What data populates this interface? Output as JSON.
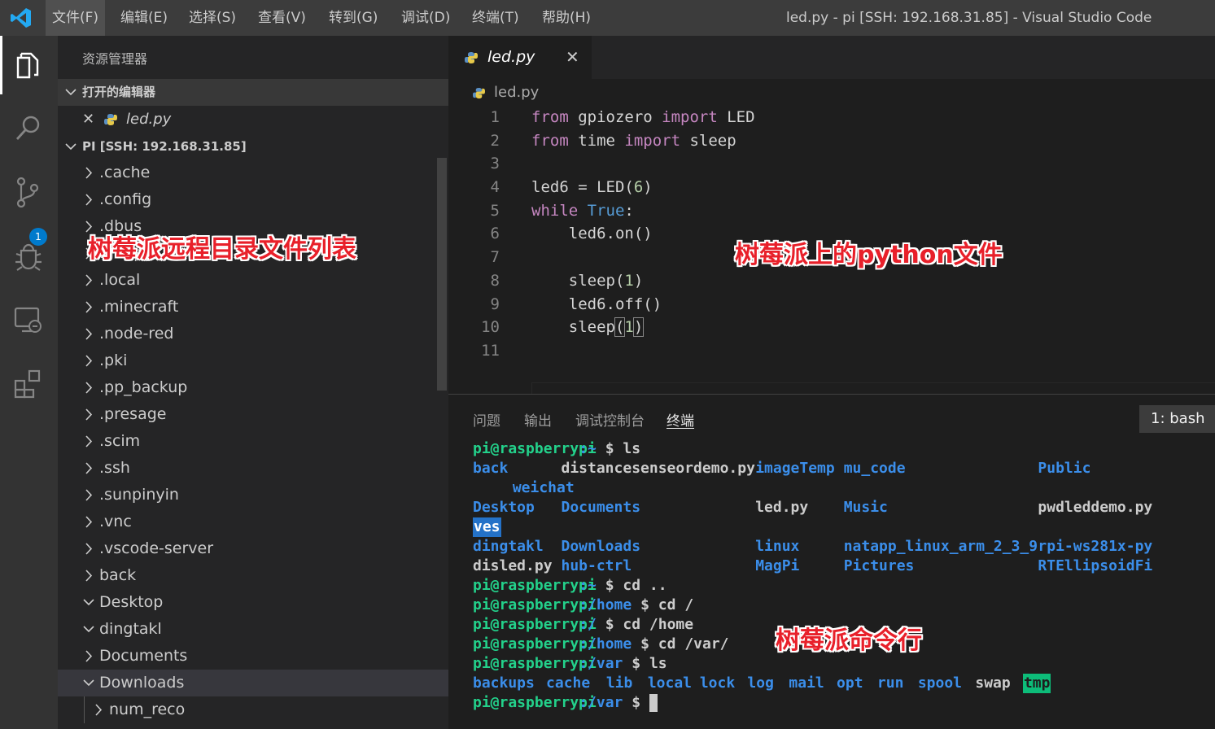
{
  "menu": [
    "文件(F)",
    "编辑(E)",
    "选择(S)",
    "查看(V)",
    "转到(G)",
    "调试(D)",
    "终端(T)",
    "帮助(H)"
  ],
  "window_title": "led.py - pi [SSH: 192.168.31.85] - Visual Studio Code",
  "activity_bar": {
    "icons": [
      "explorer-icon",
      "search-icon",
      "source-control-icon",
      "debug-icon",
      "remote-explorer-icon",
      "extensions-icon"
    ],
    "scm_badge": "1"
  },
  "sidebar": {
    "title": "资源管理器",
    "open_editors_header": "打开的编辑器",
    "open_editor_close": "✕",
    "open_editor_file": "led.py",
    "workspace_header": "PI [SSH: 192.168.31.85]",
    "tree": [
      {
        "label": ".cache",
        "expanded": false,
        "indent": 0
      },
      {
        "label": ".config",
        "expanded": false,
        "indent": 0
      },
      {
        "label": ".dbus",
        "expanded": false,
        "indent": 0
      },
      {
        "label": ".gnupg",
        "expanded": false,
        "indent": 0
      },
      {
        "label": ".local",
        "expanded": false,
        "indent": 0
      },
      {
        "label": ".minecraft",
        "expanded": false,
        "indent": 0
      },
      {
        "label": ".node-red",
        "expanded": false,
        "indent": 0
      },
      {
        "label": ".pki",
        "expanded": false,
        "indent": 0
      },
      {
        "label": ".pp_backup",
        "expanded": false,
        "indent": 0
      },
      {
        "label": ".presage",
        "expanded": false,
        "indent": 0
      },
      {
        "label": ".scim",
        "expanded": false,
        "indent": 0
      },
      {
        "label": ".ssh",
        "expanded": false,
        "indent": 0
      },
      {
        "label": ".sunpinyin",
        "expanded": false,
        "indent": 0
      },
      {
        "label": ".vnc",
        "expanded": false,
        "indent": 0
      },
      {
        "label": ".vscode-server",
        "expanded": false,
        "indent": 0
      },
      {
        "label": "back",
        "expanded": false,
        "indent": 0
      },
      {
        "label": "Desktop",
        "expanded": true,
        "indent": 0
      },
      {
        "label": "dingtakl",
        "expanded": true,
        "indent": 0
      },
      {
        "label": "Documents",
        "expanded": false,
        "indent": 0
      },
      {
        "label": "Downloads",
        "expanded": true,
        "indent": 0,
        "selected": true
      },
      {
        "label": "num_reco",
        "expanded": false,
        "indent": 1
      }
    ]
  },
  "editor": {
    "tab_label": "led.py",
    "tab_close": "✕",
    "breadcrumb": "led.py",
    "lines": [
      {
        "n": "1",
        "tokens": [
          [
            "kw",
            "from"
          ],
          [
            "t",
            " gpiozero "
          ],
          [
            "kw",
            "import"
          ],
          [
            "t",
            " LED"
          ]
        ]
      },
      {
        "n": "2",
        "tokens": [
          [
            "kw",
            "from"
          ],
          [
            "t",
            " time "
          ],
          [
            "kw",
            "import"
          ],
          [
            "t",
            " sleep"
          ]
        ]
      },
      {
        "n": "3",
        "tokens": []
      },
      {
        "n": "4",
        "tokens": [
          [
            "t",
            "led6 = LED("
          ],
          [
            "num",
            "6"
          ],
          [
            "t",
            ")"
          ]
        ]
      },
      {
        "n": "5",
        "tokens": [
          [
            "kw",
            "while"
          ],
          [
            "t",
            " "
          ],
          [
            "kw2",
            "True"
          ],
          [
            "t",
            ":"
          ]
        ]
      },
      {
        "n": "6",
        "tokens": [
          [
            "t",
            "    led6.on()"
          ]
        ]
      },
      {
        "n": "7",
        "tokens": []
      },
      {
        "n": "8",
        "tokens": [
          [
            "t",
            "    sleep("
          ],
          [
            "num",
            "1"
          ],
          [
            "t",
            ")"
          ]
        ]
      },
      {
        "n": "9",
        "tokens": [
          [
            "t",
            "    led6.off()"
          ]
        ]
      },
      {
        "n": "10",
        "tokens": [
          [
            "t",
            "    sleep"
          ],
          [
            "brk",
            "("
          ],
          [
            "num",
            "1"
          ],
          [
            "brk",
            ")"
          ]
        ]
      },
      {
        "n": "11",
        "tokens": []
      }
    ]
  },
  "panel": {
    "tabs": [
      "问题",
      "输出",
      "调试控制台",
      "终端"
    ],
    "active_tab": "终端",
    "terminal_select": "1: bash",
    "terminal_lines": [
      [
        [
          "g",
          "pi@raspberrypi",
          0
        ],
        [
          "b",
          ":~",
          12
        ],
        [
          "w",
          " $ ls",
          14
        ]
      ],
      [
        [
          "b",
          "back",
          0
        ],
        [
          "w",
          "distancesenseordemo.py",
          10
        ],
        [
          "b",
          "imageTemp",
          32
        ],
        [
          "b",
          "mu_code",
          42
        ],
        [
          "b",
          "Public",
          64
        ]
      ],
      [
        [
          "b",
          "weichat",
          4.5
        ]
      ],
      [
        [
          "b",
          "Desktop",
          0
        ],
        [
          "b",
          "Documents",
          10
        ],
        [
          "w",
          "led.py",
          32
        ],
        [
          "b",
          "Music",
          42
        ],
        [
          "w",
          "pwdleddemo.py",
          64
        ]
      ],
      [
        [
          "hl",
          "ves",
          0
        ]
      ],
      [
        [
          "b",
          "dingtakl",
          0
        ],
        [
          "b",
          "Downloads",
          10
        ],
        [
          "b",
          "linux",
          32
        ],
        [
          "b",
          "natapp_linux_arm_2_3_9",
          42
        ],
        [
          "b",
          "rpi-ws281x-py",
          64
        ]
      ],
      [
        [
          "w",
          "disled.py",
          0
        ],
        [
          "b",
          "hub-ctrl",
          10
        ],
        [
          "b",
          "MagPi",
          32
        ],
        [
          "b",
          "Pictures",
          42
        ],
        [
          "b",
          "RTEllipsoidFi",
          64
        ]
      ],
      [
        [
          "g",
          "pi@raspberrypi",
          0
        ],
        [
          "b",
          ":~",
          12
        ],
        [
          "w",
          " $ cd ..",
          14
        ]
      ],
      [
        [
          "g",
          "pi@raspberrypi",
          0
        ],
        [
          "b",
          ":/home",
          12
        ],
        [
          "w",
          " $ cd /",
          18
        ]
      ],
      [
        [
          "g",
          "pi@raspberrypi",
          0
        ],
        [
          "b",
          ":/",
          12
        ],
        [
          "w",
          " $ cd /home",
          14
        ]
      ],
      [
        [
          "g",
          "pi@raspberrypi",
          0
        ],
        [
          "b",
          ":/home",
          12
        ],
        [
          "w",
          " $ cd /var/",
          18
        ]
      ],
      [
        [
          "g",
          "pi@raspberrypi",
          0
        ],
        [
          "b",
          ":/var",
          12
        ],
        [
          "w",
          " $ ls",
          17
        ]
      ],
      [
        [
          "b",
          "backups",
          0
        ],
        [
          "b",
          "cache",
          8.3
        ],
        [
          "b",
          "lib",
          15.1
        ],
        [
          "b",
          "local",
          19.8
        ],
        [
          "b",
          "lock",
          25.7
        ],
        [
          "b",
          "log",
          31.1
        ],
        [
          "b",
          "mail",
          35.8
        ],
        [
          "b",
          "opt",
          41.2
        ],
        [
          "b",
          "run",
          45.8
        ],
        [
          "b",
          "spool",
          50.4
        ],
        [
          "w",
          "swap",
          56.9
        ],
        [
          "tmp",
          "tmp",
          62.3
        ]
      ],
      [
        [
          "g",
          "pi@raspberrypi",
          0
        ],
        [
          "b",
          ":/var",
          12
        ],
        [
          "w",
          " $ ",
          17
        ]
      ]
    ]
  },
  "annotations": {
    "sidebar_note": "树莓派远程目录文件列表",
    "editor_note": "树莓派上的python文件",
    "terminal_note": "树莓派命令行"
  }
}
